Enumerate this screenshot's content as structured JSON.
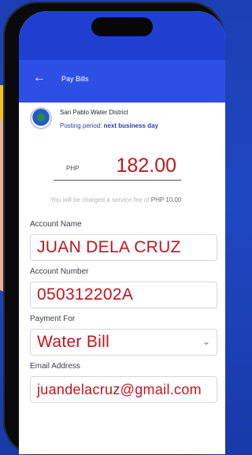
{
  "app_header": {
    "back_icon": "arrow-left-icon",
    "title": "Pay Bills"
  },
  "biller": {
    "name": "San Pablo Water District",
    "posting_label": "Posting period:",
    "posting_value": "next business day"
  },
  "payment": {
    "currency": "PHP",
    "amount": "182.00",
    "fee_note_prefix": "You will be charged a service fee of",
    "fee_value": "PHP 10.00"
  },
  "form": {
    "account_name": {
      "label": "Account Name",
      "value": "JUAN DELA CRUZ"
    },
    "account_number": {
      "label": "Account Number",
      "value": "050312202A"
    },
    "payment_for": {
      "label": "Payment For",
      "value": "Water Bill"
    },
    "email": {
      "label": "Email Address",
      "value": "juandelacruz@gmail.com"
    }
  }
}
